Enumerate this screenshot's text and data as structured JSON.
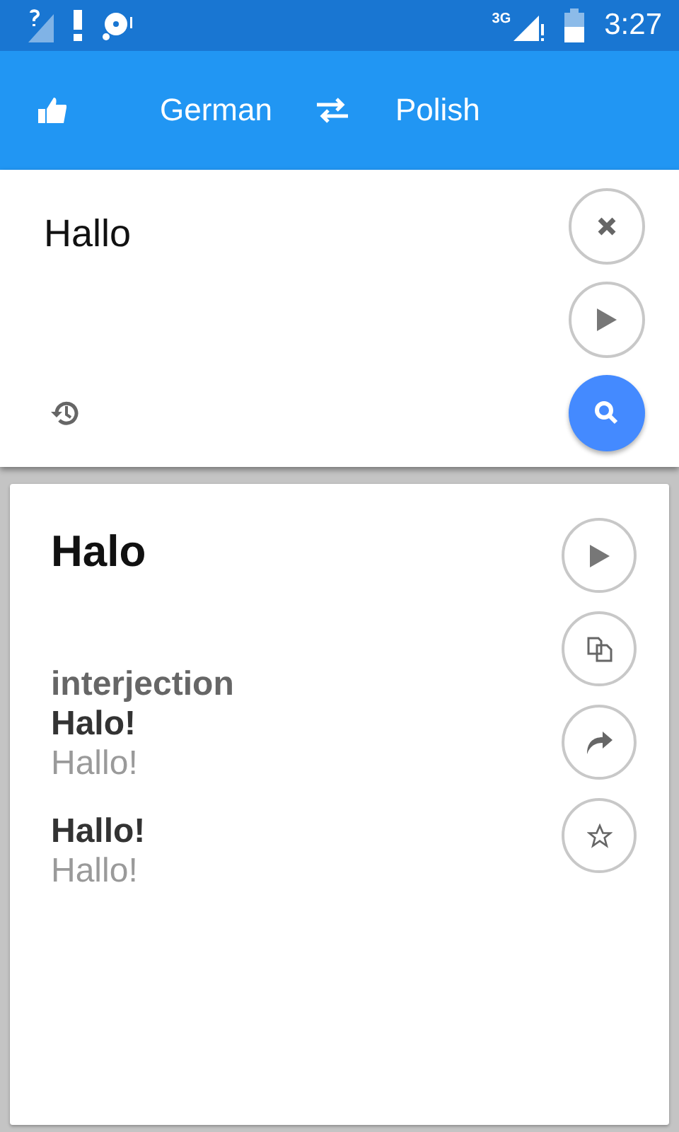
{
  "status_bar": {
    "network": "3G",
    "time": "3:27"
  },
  "toolbar": {
    "source_language": "German",
    "target_language": "Polish"
  },
  "input": {
    "value": "Hallo"
  },
  "result": {
    "headword": "Halo",
    "entries": [
      {
        "part_of_speech": "interjection",
        "translation": "Halo!",
        "example": "Hallo!"
      },
      {
        "translation": "Hallo!",
        "example": "Hallo!"
      }
    ]
  }
}
